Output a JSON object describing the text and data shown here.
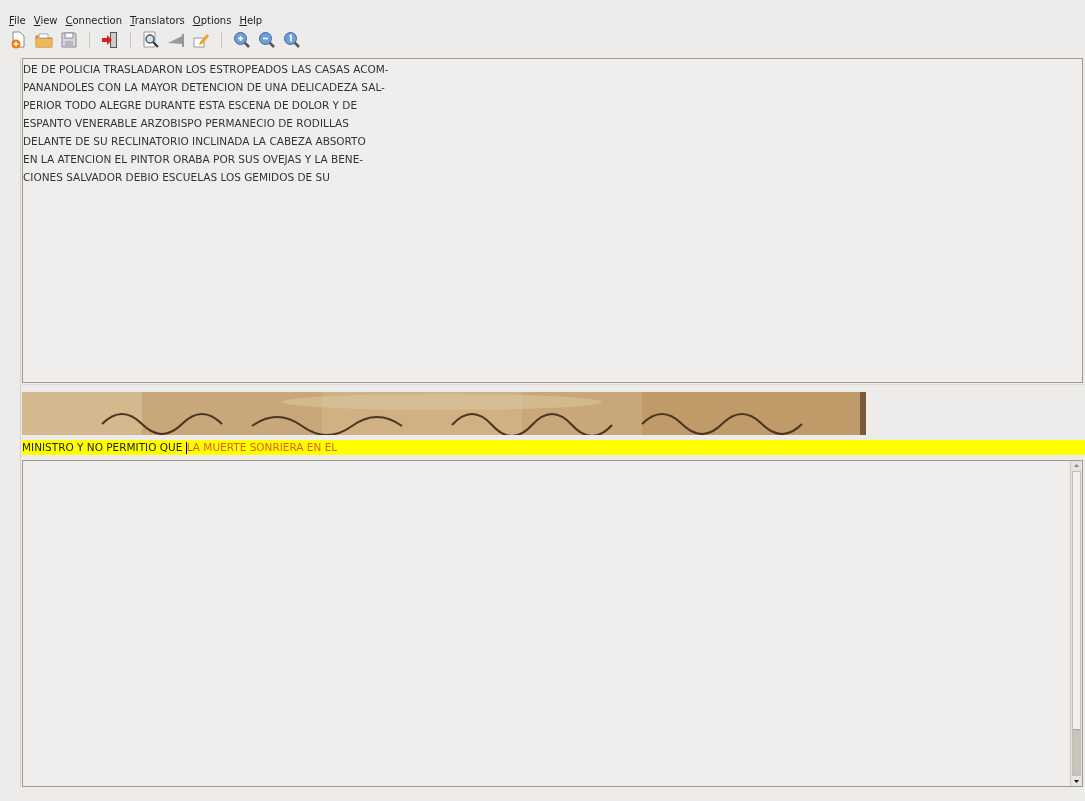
{
  "menu_bar": [
    {
      "label": "File"
    },
    {
      "label": "View"
    },
    {
      "label": "Connection"
    },
    {
      "label": "Translators"
    },
    {
      "label": "Options"
    },
    {
      "label": "Help"
    }
  ],
  "toolbar": [
    {
      "kind": "new"
    },
    {
      "kind": "open"
    },
    {
      "kind": "save"
    },
    {
      "kind": "separator"
    },
    {
      "kind": "connect"
    },
    {
      "kind": "separator"
    },
    {
      "kind": "preview"
    },
    {
      "kind": "wedge"
    },
    {
      "kind": "edit"
    },
    {
      "kind": "separator"
    },
    {
      "kind": "zoom-in"
    },
    {
      "kind": "zoom-out"
    },
    {
      "kind": "zoom-reset"
    }
  ],
  "transcript_lines": [
    "DE DE POLICIA TRASLADARON LOS ESTROPEADOS LAS CASAS ACOM-",
    "PANANDOLES CON LA MAYOR DETENCION DE UNA DELICADEZA SAL-",
    "PERIOR TODO ALEGRE DURANTE ESTA ESCENA DE DOLOR Y DE",
    "ESPANTO VENERABLE ARZOBISPO PERMANECIO DE RODILLAS",
    "DELANTE DE SU RECLINATORIO INCLINADA LA CABEZA ABSORTO",
    "EN LA ATENCION EL PINTOR ORABA POR SUS OVEJAS Y LA BENE-",
    "CIONES SALVADOR DEBIO ESCUELAS LOS GEMIDOS DE SU"
  ],
  "prediction_line": [
    {
      "kind": "accepted",
      "text": "MINISTRO Y NO PERMITIO QUE "
    },
    {
      "kind": "caret"
    },
    {
      "kind": "suggested",
      "text": "LA MUERTE SONRIERA EN EL"
    }
  ]
}
